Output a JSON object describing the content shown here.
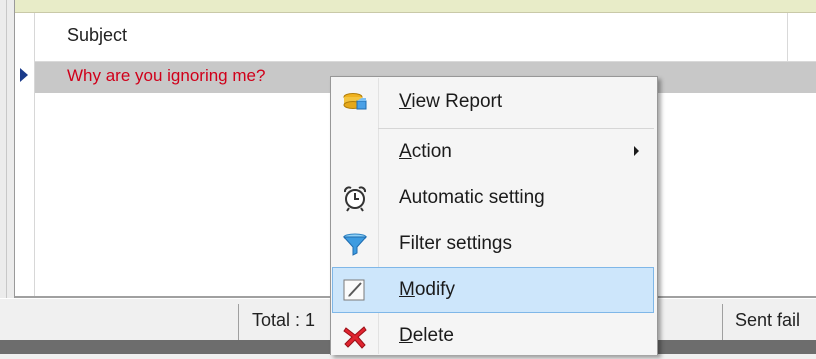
{
  "grid": {
    "header_subject": "Subject",
    "rows": [
      {
        "subject": "Why are you ignoring me?"
      }
    ]
  },
  "status_bar": {
    "total": "Total : 1",
    "sent": "Sent fail"
  },
  "context_menu": {
    "items": [
      {
        "label": "View Report",
        "accel_index": 0,
        "icon": "report-icon"
      },
      {
        "label": "Action",
        "accel_index": 0,
        "icon": "",
        "submenu": true
      },
      {
        "label": "Automatic setting",
        "accel_index": -1,
        "icon": "alarm-clock-icon"
      },
      {
        "label": "Filter settings",
        "accel_index": -1,
        "icon": "funnel-icon"
      },
      {
        "label": "Modify",
        "accel_index": 0,
        "icon": "pencil-icon",
        "highlighted": true
      },
      {
        "label": "Delete",
        "accel_index": 0,
        "icon": "red-x-icon"
      }
    ]
  },
  "colors": {
    "row_text": "#d0001a",
    "selected_row": "#c8c8c8",
    "highlight": "#cde6fb",
    "highlight_border": "#7fb7e8"
  }
}
